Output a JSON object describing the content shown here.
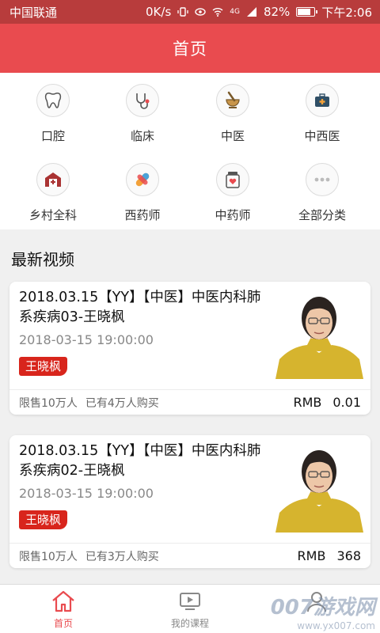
{
  "status_bar": {
    "carrier": "中国联通",
    "speed": "0K/s",
    "network": "4G",
    "battery": "82%",
    "battery_level": 0.82,
    "time": "下午2:06"
  },
  "header": {
    "title": "首页"
  },
  "categories": [
    {
      "label": "口腔",
      "icon": "tooth-icon"
    },
    {
      "label": "临床",
      "icon": "stethoscope-icon"
    },
    {
      "label": "中医",
      "icon": "mortar-pestle-icon"
    },
    {
      "label": "中西医",
      "icon": "medical-kit-icon"
    },
    {
      "label": "乡村全科",
      "icon": "hospital-icon"
    },
    {
      "label": "西药师",
      "icon": "capsule-icon"
    },
    {
      "label": "中药师",
      "icon": "medicine-jar-icon"
    },
    {
      "label": "全部分类",
      "icon": "more-icon"
    }
  ],
  "section": {
    "title": "最新视频"
  },
  "videos": [
    {
      "title": "2018.03.15【YY】【中医】中医内科肺系疾病03-王晓枫",
      "datetime": "2018-03-15 19:00:00",
      "teacher": "王晓枫",
      "limit": "限售10万人",
      "sold": "已有4万人购买",
      "currency": "RMB",
      "price": "0.01"
    },
    {
      "title": "2018.03.15【YY】【中医】中医内科肺系疾病02-王晓枫",
      "datetime": "2018-03-15 19:00:00",
      "teacher": "王晓枫",
      "limit": "限售10万人",
      "sold": "已有3万人购买",
      "currency": "RMB",
      "price": "368"
    }
  ],
  "tabs": [
    {
      "label": "首页",
      "icon": "home-icon",
      "active": true
    },
    {
      "label": "我的课程",
      "icon": "play-screen-icon",
      "active": false
    },
    {
      "label": "",
      "icon": "user-icon",
      "active": false
    }
  ],
  "watermark": {
    "line1": "007游戏网",
    "line2": "www.yx007.com"
  },
  "colors": {
    "status_bar": "#b83c3c",
    "header": "#e94b4f",
    "tag": "#d8251c",
    "accent": "#e94b4f"
  }
}
